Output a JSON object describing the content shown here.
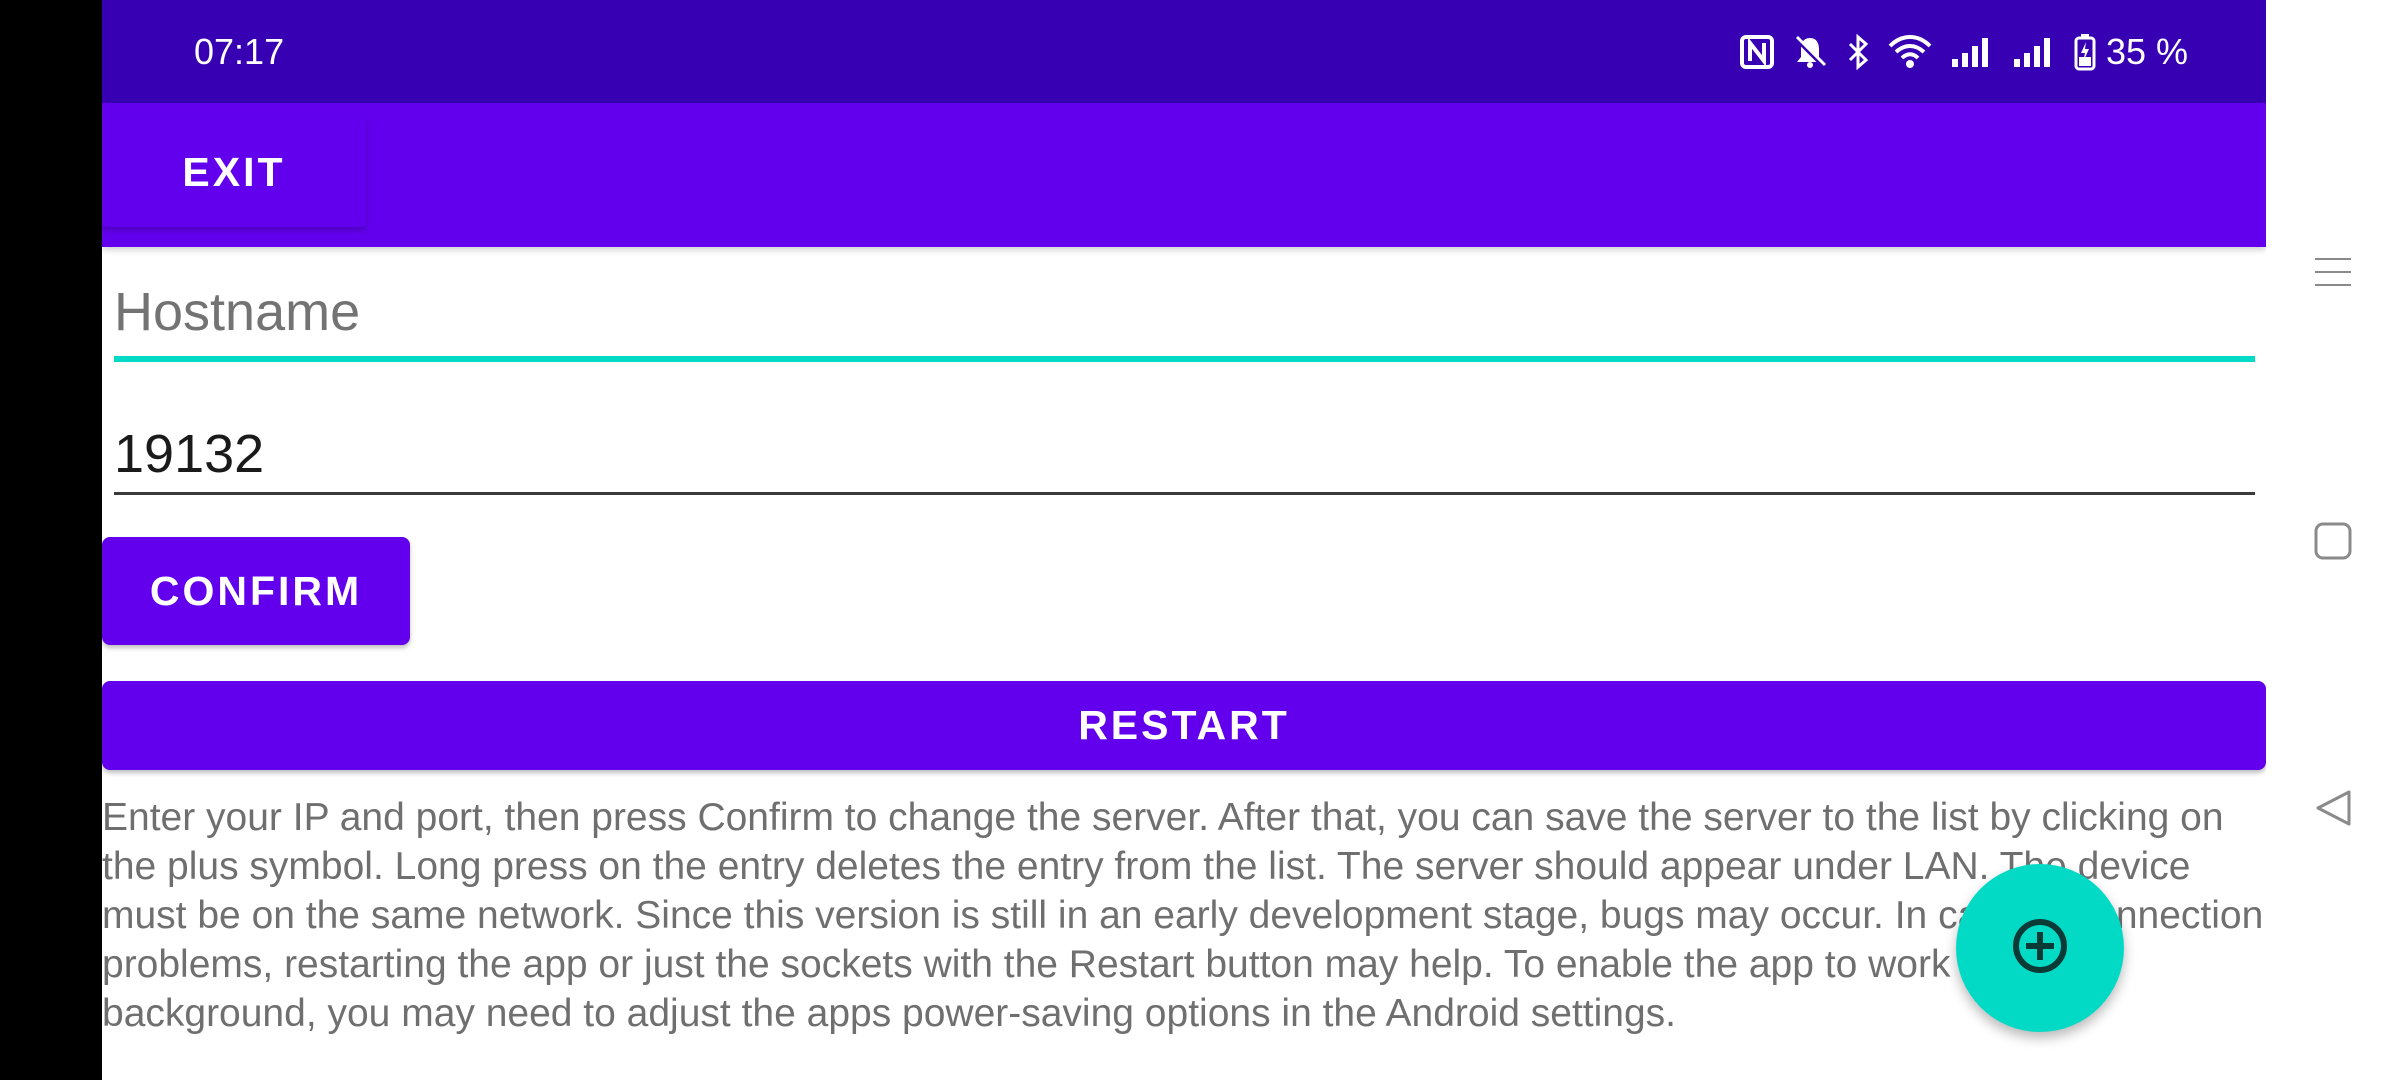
{
  "status_bar": {
    "time": "07:17",
    "battery_percent": "35 %",
    "icons": [
      "nfc-icon",
      "bell-muted-icon",
      "bluetooth-icon",
      "wifi-icon",
      "signal-icon",
      "signal-icon",
      "battery-charging-icon"
    ]
  },
  "app_bar": {
    "exit_label": "EXIT"
  },
  "form": {
    "hostname": {
      "value": "",
      "placeholder": "Hostname"
    },
    "port": {
      "value": "19132"
    },
    "confirm_label": "CONFIRM",
    "restart_label": "RESTART"
  },
  "info_text": "Enter your IP and port, then press Confirm to change the server. After that, you can save the server to the list by clicking on the plus symbol. Long press on the entry deletes the entry from the list. The server should appear under LAN. The device must be on the same network. Since this version is still in an early development stage, bugs may occur. In case of connection problems, restarting the app or just the sockets with the Restart button may help. To enable the app to work in the background, you may need to adjust the apps power-saving options in the Android settings.",
  "fab": {
    "icon": "add-circle-icon"
  },
  "navigation_bar": {
    "buttons": [
      "menu-icon",
      "home-square-icon",
      "back-triangle-icon"
    ]
  },
  "colors": {
    "status_bar": "#3700b3",
    "primary": "#6200ee",
    "accent": "#03dac6",
    "text_secondary": "#6f6f6f"
  }
}
